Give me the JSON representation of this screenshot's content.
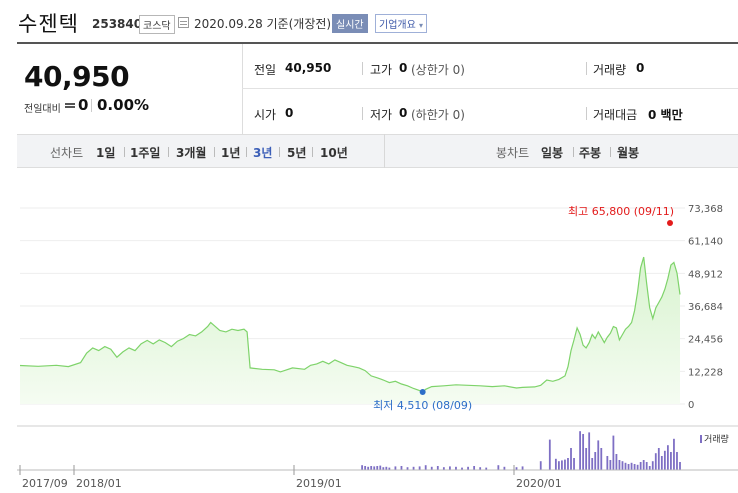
{
  "header": {
    "company_name": "수젠텍",
    "code": "253840",
    "market_badge": "코스닥",
    "date_text": "2020.09.28 기준(개장전)",
    "realtime_badge": "실시간",
    "overview_button": "기업개요",
    "overview_icon": "chevron-down-icon"
  },
  "price": {
    "current": "40,950",
    "diff_label": "전일대비",
    "diff_value": "0",
    "diff_percent": "0.00%"
  },
  "stats": {
    "prev_close_label": "전일",
    "prev_close_value": "40,950",
    "high_label": "고가",
    "high_value": "0",
    "high_limit": "(상한가 0)",
    "volume_label": "거래량",
    "volume_value": "0",
    "open_label": "시가",
    "open_value": "0",
    "low_label": "저가",
    "low_value": "0",
    "low_limit": "(하한가 0)",
    "amount_label": "거래대금",
    "amount_value": "0 백만"
  },
  "range_tabs": {
    "line_label": "선차트",
    "line_items": [
      "1일",
      "1주일",
      "3개월",
      "1년",
      "3년",
      "5년",
      "10년"
    ],
    "selected": "3년",
    "candle_label": "봉차트",
    "candle_items": [
      "일봉",
      "주봉",
      "월봉"
    ]
  },
  "chart_data": {
    "type": "area",
    "y_ticks": [
      "73,368",
      "61,140",
      "48,912",
      "36,684",
      "24,456",
      "12,228",
      "0"
    ],
    "ylim": [
      0,
      73368
    ],
    "x_ticks": [
      "2017/09",
      "2018/01",
      "2019/01",
      "2020/01"
    ],
    "max_annotation": "최고 65,800 (09/11)",
    "min_annotation": "최저 4,510 (08/09)",
    "volume_legend": "거래량",
    "colors": {
      "line": "#7ed36a",
      "fill_top": "#d8f3cf",
      "fill_bottom": "#f5fcf2",
      "max": "#e31b1b",
      "min": "#2d6ec8",
      "volume": "#7e6fc4",
      "grid": "#eeeeee"
    },
    "price_series": [
      [
        0.0,
        14400
      ],
      [
        0.03,
        14100
      ],
      [
        0.06,
        14500
      ],
      [
        0.08,
        14000
      ],
      [
        0.1,
        15500
      ],
      [
        0.11,
        19000
      ],
      [
        0.12,
        21000
      ],
      [
        0.13,
        20000
      ],
      [
        0.14,
        21500
      ],
      [
        0.15,
        20500
      ],
      [
        0.16,
        17500
      ],
      [
        0.17,
        19500
      ],
      [
        0.18,
        21000
      ],
      [
        0.19,
        20000
      ],
      [
        0.2,
        22500
      ],
      [
        0.21,
        23800
      ],
      [
        0.22,
        22500
      ],
      [
        0.23,
        24000
      ],
      [
        0.24,
        23000
      ],
      [
        0.25,
        21500
      ],
      [
        0.26,
        23500
      ],
      [
        0.27,
        24500
      ],
      [
        0.28,
        26000
      ],
      [
        0.29,
        25500
      ],
      [
        0.3,
        27000
      ],
      [
        0.31,
        29000
      ],
      [
        0.315,
        30500
      ],
      [
        0.32,
        29500
      ],
      [
        0.33,
        27500
      ],
      [
        0.34,
        27000
      ],
      [
        0.35,
        28000
      ],
      [
        0.36,
        27500
      ],
      [
        0.37,
        28000
      ],
      [
        0.375,
        27000
      ],
      [
        0.38,
        13500
      ],
      [
        0.4,
        13000
      ],
      [
        0.42,
        12800
      ],
      [
        0.43,
        12000
      ],
      [
        0.45,
        13500
      ],
      [
        0.47,
        13000
      ],
      [
        0.48,
        14500
      ],
      [
        0.49,
        15000
      ],
      [
        0.5,
        16000
      ],
      [
        0.51,
        15000
      ],
      [
        0.52,
        16500
      ],
      [
        0.53,
        15500
      ],
      [
        0.54,
        14500
      ],
      [
        0.55,
        14000
      ],
      [
        0.56,
        13500
      ],
      [
        0.57,
        12500
      ],
      [
        0.58,
        10500
      ],
      [
        0.59,
        9800
      ],
      [
        0.6,
        9000
      ],
      [
        0.61,
        8000
      ],
      [
        0.62,
        8500
      ],
      [
        0.63,
        7500
      ],
      [
        0.64,
        6800
      ],
      [
        0.65,
        5800
      ],
      [
        0.66,
        5000
      ],
      [
        0.665,
        4510
      ],
      [
        0.67,
        5500
      ],
      [
        0.68,
        6500
      ],
      [
        0.7,
        6800
      ],
      [
        0.72,
        7200
      ],
      [
        0.74,
        7000
      ],
      [
        0.76,
        6800
      ],
      [
        0.78,
        6500
      ],
      [
        0.8,
        6800
      ],
      [
        0.82,
        6000
      ],
      [
        0.83,
        6200
      ],
      [
        0.85,
        6400
      ],
      [
        0.86,
        7000
      ],
      [
        0.87,
        9000
      ],
      [
        0.88,
        8500
      ],
      [
        0.89,
        9200
      ],
      [
        0.9,
        10500
      ],
      [
        0.905,
        14000
      ],
      [
        0.91,
        20000
      ],
      [
        0.915,
        24000
      ],
      [
        0.92,
        28500
      ],
      [
        0.925,
        26000
      ],
      [
        0.93,
        22000
      ],
      [
        0.935,
        21000
      ],
      [
        0.94,
        23000
      ],
      [
        0.945,
        26000
      ],
      [
        0.95,
        24500
      ],
      [
        0.955,
        27000
      ],
      [
        0.96,
        25000
      ],
      [
        0.965,
        23000
      ],
      [
        0.97,
        25000
      ],
      [
        0.975,
        26500
      ],
      [
        0.98,
        29000
      ],
      [
        0.985,
        28500
      ],
      [
        0.99,
        24000
      ],
      [
        0.995,
        26000
      ],
      [
        1.0,
        28000
      ],
      [
        1.005,
        29000
      ],
      [
        1.01,
        30500
      ],
      [
        1.015,
        35000
      ],
      [
        1.02,
        42000
      ],
      [
        1.025,
        51000
      ],
      [
        1.03,
        55000
      ],
      [
        1.035,
        45000
      ],
      [
        1.04,
        36000
      ],
      [
        1.045,
        32000
      ],
      [
        1.05,
        36000
      ],
      [
        1.055,
        38000
      ],
      [
        1.06,
        40000
      ],
      [
        1.065,
        43000
      ],
      [
        1.07,
        47000
      ],
      [
        1.075,
        52000
      ],
      [
        1.08,
        53000
      ],
      [
        1.085,
        49000
      ],
      [
        1.09,
        41000
      ]
    ],
    "volume_bars": [
      [
        0.565,
        0.12
      ],
      [
        0.57,
        0.1
      ],
      [
        0.575,
        0.08
      ],
      [
        0.58,
        0.1
      ],
      [
        0.585,
        0.09
      ],
      [
        0.59,
        0.1
      ],
      [
        0.595,
        0.11
      ],
      [
        0.6,
        0.07
      ],
      [
        0.605,
        0.08
      ],
      [
        0.61,
        0.06
      ],
      [
        0.62,
        0.09
      ],
      [
        0.63,
        0.1
      ],
      [
        0.64,
        0.07
      ],
      [
        0.65,
        0.08
      ],
      [
        0.66,
        0.09
      ],
      [
        0.67,
        0.12
      ],
      [
        0.68,
        0.08
      ],
      [
        0.69,
        0.1
      ],
      [
        0.7,
        0.07
      ],
      [
        0.71,
        0.09
      ],
      [
        0.72,
        0.08
      ],
      [
        0.73,
        0.06
      ],
      [
        0.74,
        0.08
      ],
      [
        0.75,
        0.1
      ],
      [
        0.76,
        0.07
      ],
      [
        0.77,
        0.06
      ],
      [
        0.79,
        0.12
      ],
      [
        0.8,
        0.08
      ],
      [
        0.82,
        0.07
      ],
      [
        0.83,
        0.09
      ],
      [
        0.86,
        0.22
      ],
      [
        0.875,
        0.76
      ],
      [
        0.885,
        0.28
      ],
      [
        0.89,
        0.22
      ],
      [
        0.895,
        0.24
      ],
      [
        0.9,
        0.26
      ],
      [
        0.905,
        0.3
      ],
      [
        0.91,
        0.55
      ],
      [
        0.915,
        0.3
      ],
      [
        0.925,
        0.97
      ],
      [
        0.93,
        0.9
      ],
      [
        0.935,
        0.55
      ],
      [
        0.94,
        0.94
      ],
      [
        0.945,
        0.3
      ],
      [
        0.95,
        0.45
      ],
      [
        0.955,
        0.74
      ],
      [
        0.96,
        0.55
      ],
      [
        0.97,
        0.35
      ],
      [
        0.975,
        0.25
      ],
      [
        0.98,
        0.86
      ],
      [
        0.985,
        0.4
      ],
      [
        0.99,
        0.25
      ],
      [
        0.995,
        0.22
      ],
      [
        1.0,
        0.18
      ],
      [
        1.005,
        0.15
      ],
      [
        1.01,
        0.18
      ],
      [
        1.015,
        0.15
      ],
      [
        1.02,
        0.13
      ],
      [
        1.025,
        0.2
      ],
      [
        1.03,
        0.25
      ],
      [
        1.035,
        0.2
      ],
      [
        1.04,
        0.1
      ],
      [
        1.045,
        0.22
      ],
      [
        1.05,
        0.42
      ],
      [
        1.055,
        0.55
      ],
      [
        1.06,
        0.35
      ],
      [
        1.065,
        0.48
      ],
      [
        1.07,
        0.62
      ],
      [
        1.075,
        0.45
      ],
      [
        1.08,
        0.78
      ],
      [
        1.085,
        0.45
      ],
      [
        1.09,
        0.2
      ]
    ]
  }
}
